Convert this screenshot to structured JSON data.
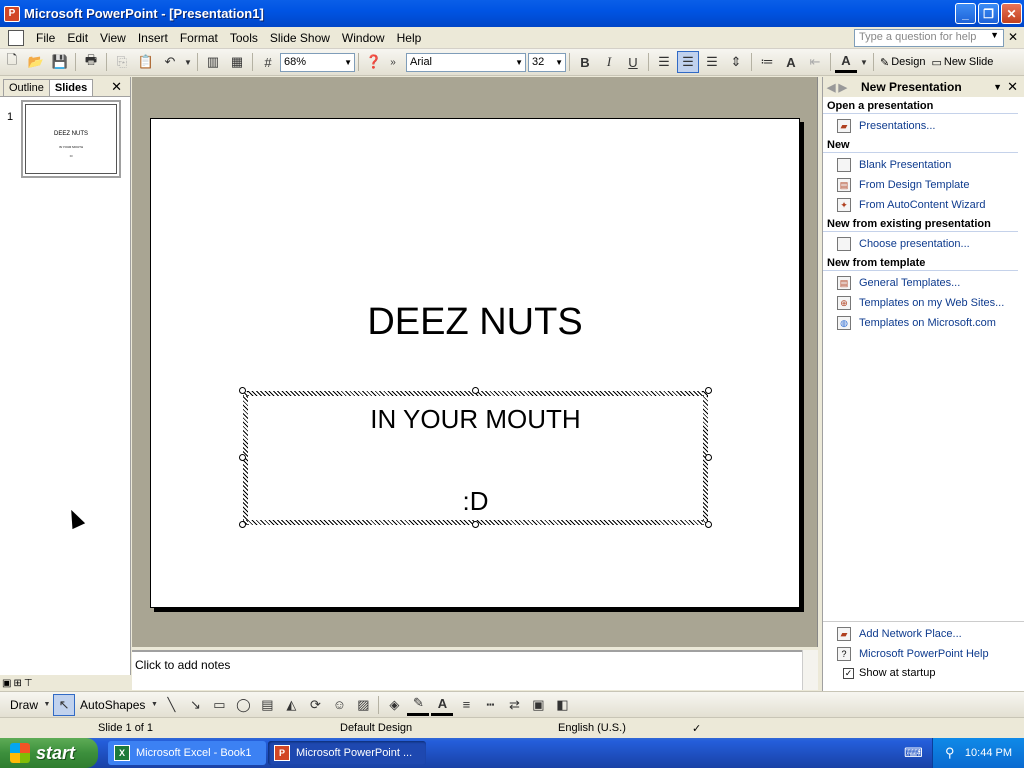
{
  "window": {
    "title": "Microsoft PowerPoint - [Presentation1]",
    "minimize": "_",
    "maximize": "❐",
    "close": "✕"
  },
  "menu": {
    "items": [
      "File",
      "Edit",
      "View",
      "Insert",
      "Format",
      "Tools",
      "Slide Show",
      "Window",
      "Help"
    ],
    "help_placeholder": "Type a question for help",
    "close_doc": "✕"
  },
  "toolbar": {
    "zoom": "68%",
    "font": "Arial",
    "font_size": "32",
    "bold": "B",
    "italic": "I",
    "underline": "U",
    "design_label": "Design",
    "new_slide_label": "New Slide"
  },
  "left_pane": {
    "tabs": [
      "Outline",
      "Slides"
    ],
    "active_tab": "Slides",
    "slide_number": "1"
  },
  "slide": {
    "title": "DEEZ NUTS",
    "subtitle_line1": "IN YOUR MOUTH",
    "subtitle_line2": ":D"
  },
  "notes": {
    "placeholder": "Click to add notes"
  },
  "task_pane": {
    "title": "New Presentation",
    "sections": [
      {
        "heading": "Open a presentation",
        "links": [
          "Presentations..."
        ]
      },
      {
        "heading": "New",
        "links": [
          "Blank Presentation",
          "From Design Template",
          "From AutoContent Wizard"
        ]
      },
      {
        "heading": "New from existing presentation",
        "links": [
          "Choose presentation..."
        ]
      },
      {
        "heading": "New from template",
        "links": [
          "General Templates...",
          "Templates on my Web Sites...",
          "Templates on Microsoft.com"
        ]
      }
    ],
    "bottom_links": [
      "Add Network Place...",
      "Microsoft PowerPoint Help"
    ],
    "show_at_startup": "Show at startup",
    "show_at_startup_checked": true
  },
  "drawbar": {
    "draw_label": "Draw",
    "autoshapes_label": "AutoShapes"
  },
  "status": {
    "slide": "Slide 1 of 1",
    "design": "Default Design",
    "language": "English (U.S.)"
  },
  "taskbar": {
    "start_label": "start",
    "tasks": [
      "Microsoft Excel - Book1",
      "Microsoft PowerPoint ..."
    ],
    "active_task": 1,
    "clock": "10:44 PM"
  }
}
